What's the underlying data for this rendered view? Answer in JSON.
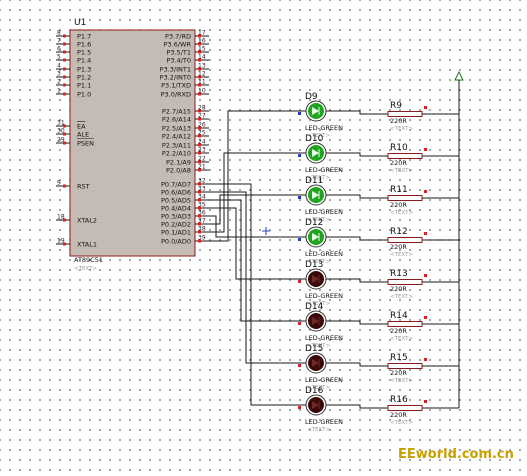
{
  "chip": {
    "ref": "U1",
    "part": "AT89C51",
    "text_placeholder": "<TEXT>",
    "left_pins": [
      {
        "num": "8",
        "name": "P1.7"
      },
      {
        "num": "7",
        "name": "P1.6"
      },
      {
        "num": "6",
        "name": "P1.5"
      },
      {
        "num": "5",
        "name": "P1.4"
      },
      {
        "num": "4",
        "name": "P1.3"
      },
      {
        "num": "3",
        "name": "P1.2"
      },
      {
        "num": "2",
        "name": "P1.1"
      },
      {
        "num": "1",
        "name": "P1.0"
      },
      {
        "num": "31",
        "name": "EA"
      },
      {
        "num": "30",
        "name": "ALE"
      },
      {
        "num": "29",
        "name": "PSEN"
      },
      {
        "num": "9",
        "name": "RST"
      },
      {
        "num": "18",
        "name": "XTAL2"
      },
      {
        "num": "19",
        "name": "XTAL1"
      }
    ],
    "right_pins": [
      {
        "num": "17",
        "name": "P3.7/RD"
      },
      {
        "num": "16",
        "name": "P3.6/WR"
      },
      {
        "num": "15",
        "name": "P3.5/T1"
      },
      {
        "num": "14",
        "name": "P3.4/T0"
      },
      {
        "num": "13",
        "name": "P3.3/INT1"
      },
      {
        "num": "12",
        "name": "P3.2/INT0"
      },
      {
        "num": "11",
        "name": "P3.1/TXD"
      },
      {
        "num": "10",
        "name": "P3.0/RXD"
      },
      {
        "num": "28",
        "name": "P2.7/A15"
      },
      {
        "num": "27",
        "name": "P2.6/A14"
      },
      {
        "num": "26",
        "name": "P2.5/A13"
      },
      {
        "num": "25",
        "name": "P2.4/A12"
      },
      {
        "num": "24",
        "name": "P2.3/A11"
      },
      {
        "num": "23",
        "name": "P2.2/A10"
      },
      {
        "num": "22",
        "name": "P2.1/A9"
      },
      {
        "num": "21",
        "name": "P2.0/A8"
      },
      {
        "num": "32",
        "name": "P0.7/AD7"
      },
      {
        "num": "33",
        "name": "P0.6/AD6"
      },
      {
        "num": "34",
        "name": "P0.5/AD5"
      },
      {
        "num": "35",
        "name": "P0.4/AD4"
      },
      {
        "num": "36",
        "name": "P0.3/AD3"
      },
      {
        "num": "37",
        "name": "P0.2/AD2"
      },
      {
        "num": "38",
        "name": "P0.1/AD1"
      },
      {
        "num": "39",
        "name": "P0.0/AD0"
      }
    ]
  },
  "leds": [
    {
      "ref": "D9",
      "label": "LED-GREEN",
      "lit": true
    },
    {
      "ref": "D10",
      "label": "LED-GREEN",
      "lit": true
    },
    {
      "ref": "D11",
      "label": "LED-GREEN",
      "lit": true
    },
    {
      "ref": "D12",
      "label": "LED-GREEN",
      "lit": true
    },
    {
      "ref": "D13",
      "label": "LED-GREEN",
      "lit": false
    },
    {
      "ref": "D14",
      "label": "LED-GREEN",
      "lit": false
    },
    {
      "ref": "D15",
      "label": "LED-GREEN",
      "lit": false
    },
    {
      "ref": "D16",
      "label": "LED-GREEN",
      "lit": false
    }
  ],
  "resistors": [
    {
      "ref": "R9",
      "value": "220R"
    },
    {
      "ref": "R10",
      "value": "220R"
    },
    {
      "ref": "R11",
      "value": "220R"
    },
    {
      "ref": "R12",
      "value": "220R"
    },
    {
      "ref": "R13",
      "value": "220R"
    },
    {
      "ref": "R14",
      "value": "220R"
    },
    {
      "ref": "R15",
      "value": "220R"
    },
    {
      "ref": "R16",
      "value": "220R"
    }
  ],
  "colors": {
    "chip_fill": "#c4bcb4",
    "chip_border": "#8b1a1a",
    "pin_dot": "#e02020",
    "led_lit": "#1fa51f",
    "led_off": "#3a0a0a",
    "resistor_fill": "#ffffff",
    "watermark": "#c8a000"
  },
  "watermark": "EEworld.com.cn"
}
